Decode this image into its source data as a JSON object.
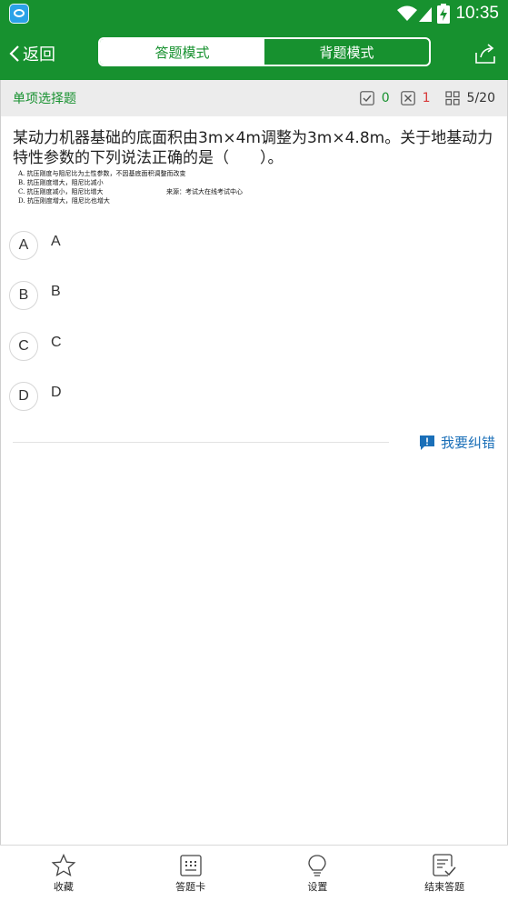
{
  "status_bar": {
    "time": "10:35",
    "icons": [
      "app-icon",
      "wifi-icon",
      "signal-icon",
      "battery-charging-icon"
    ]
  },
  "top_bar": {
    "back_label": "返回",
    "modes": [
      {
        "label": "答题模式",
        "active": true
      },
      {
        "label": "背题模式",
        "active": false
      }
    ],
    "share_icon": "share-icon"
  },
  "question_header": {
    "type": "单项选择题",
    "correct_count": "0",
    "wrong_count": "1",
    "progress": "5/20"
  },
  "question": {
    "text": "某动力机器基础的底面积由3m×4m调整为3m×4.8m。关于地基动力特性参数的下列说法正确的是（　　）。",
    "image_lines": [
      "A. 抗压刚度与阻尼比为土性参数，不因基底面积调整而改变",
      "B. 抗压刚度增大，阻尼比减小",
      "C. 抗压刚度减小，阻尼比增大",
      "D. 抗压刚度增大，阻尼比也增大"
    ],
    "image_source": "来源：考试大在线考试中心"
  },
  "options": [
    {
      "letter": "A",
      "text": "A"
    },
    {
      "letter": "B",
      "text": "B"
    },
    {
      "letter": "C",
      "text": "C"
    },
    {
      "letter": "D",
      "text": "D"
    }
  ],
  "report_label": "我要纠错",
  "bottom_nav": [
    {
      "label": "收藏",
      "icon": "star-icon"
    },
    {
      "label": "答题卡",
      "icon": "answer-card-icon"
    },
    {
      "label": "设置",
      "icon": "lightbulb-icon"
    },
    {
      "label": "结束答题",
      "icon": "finish-icon"
    }
  ],
  "colors": {
    "primary_green": "#17912f",
    "wrong_red": "#d83a3a",
    "link_blue": "#1a6fb8",
    "header_gray": "#ececec"
  }
}
